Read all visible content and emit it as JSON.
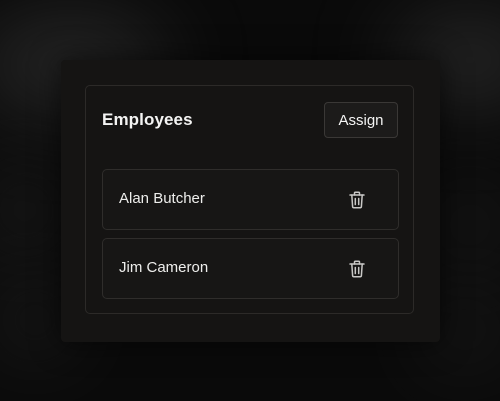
{
  "card": {
    "title": "Employees",
    "assign_label": "Assign"
  },
  "employees": [
    {
      "name": "Alan Butcher"
    },
    {
      "name": "Jim Cameron"
    }
  ],
  "icons": {
    "delete": "trash-icon"
  },
  "colors": {
    "background": "#0a0a0a",
    "panel": "#151413",
    "text": "#f4f4f3",
    "border": "#2f2d2b"
  }
}
